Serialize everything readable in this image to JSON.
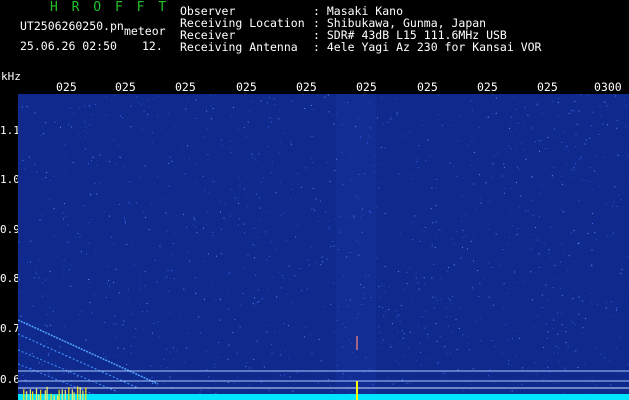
{
  "app": {
    "name": "H R O F F T"
  },
  "capture": {
    "file_name": "UT2506260250.pn",
    "mode": "meteor",
    "timestamp": "25.06.26 02:50",
    "level": "12."
  },
  "info": [
    {
      "label": "Observer",
      "value": ": Masaki Kano"
    },
    {
      "label": "Receiving Location",
      "value": ": Shibukawa, Gunma, Japan"
    },
    {
      "label": "Receiver",
      "value": ": SDR# 43dB L15 111.6MHz USB"
    },
    {
      "label": "Receiving Antenna",
      "value": ": 4ele Yagi Az 230 for Kansai VOR"
    }
  ],
  "axis": {
    "unit": "kHz",
    "time_ticks": [
      "025",
      "025",
      "025",
      "025",
      "025",
      "025",
      "025",
      "025",
      "025",
      "0300"
    ],
    "freq_ticks": [
      "1.1",
      "1.0",
      "0.9",
      "0.8",
      "0.7",
      "0.6"
    ]
  },
  "colors": {
    "background": "#0f2a8c",
    "signal": "#00e5ff",
    "meteor_ping": "#ffff00",
    "header_text": "#ffffff",
    "title_text": "#22c22a"
  }
}
